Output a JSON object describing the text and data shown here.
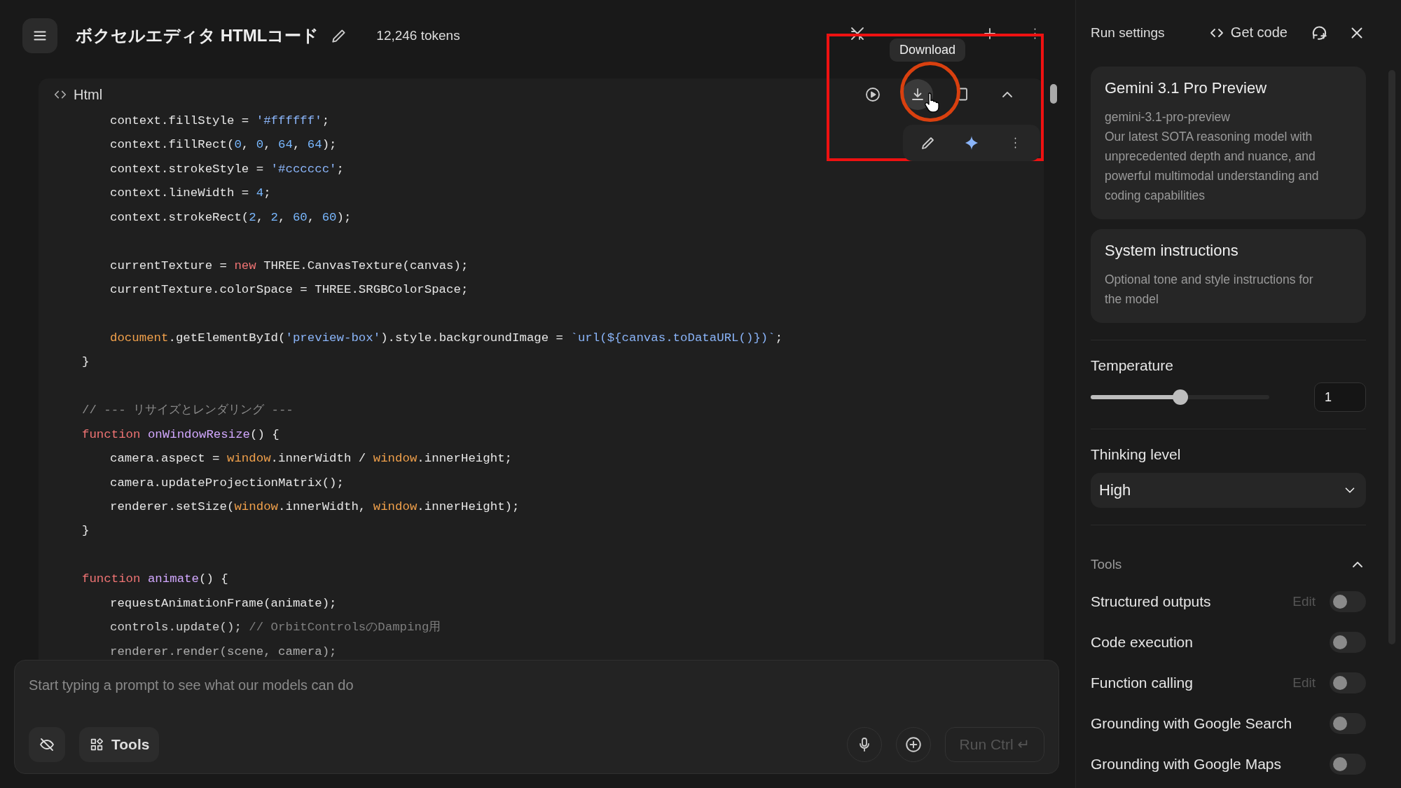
{
  "header": {
    "title": "ボクセルエディタ HTMLコード",
    "token_count": "12,246 tokens"
  },
  "code_block": {
    "language": "Html",
    "tooltip": "Download",
    "lines": [
      {
        "kind": "inner",
        "tokens": [
          {
            "text": "context.fillStyle = ",
            "kind": "plain"
          },
          {
            "text": "'#ffffff'",
            "kind": "string"
          },
          {
            "text": ";",
            "kind": "plain"
          }
        ]
      },
      {
        "kind": "inner",
        "tokens": [
          {
            "text": "context.fillRect(",
            "kind": "plain"
          },
          {
            "text": "0",
            "kind": "number"
          },
          {
            "text": ", ",
            "kind": "plain"
          },
          {
            "text": "0",
            "kind": "number"
          },
          {
            "text": ", ",
            "kind": "plain"
          },
          {
            "text": "64",
            "kind": "number"
          },
          {
            "text": ", ",
            "kind": "plain"
          },
          {
            "text": "64",
            "kind": "number"
          },
          {
            "text": ");",
            "kind": "plain"
          }
        ]
      },
      {
        "kind": "inner",
        "tokens": [
          {
            "text": "context.strokeStyle = ",
            "kind": "plain"
          },
          {
            "text": "'#cccccc'",
            "kind": "string"
          },
          {
            "text": ";",
            "kind": "plain"
          }
        ]
      },
      {
        "kind": "inner",
        "tokens": [
          {
            "text": "context.lineWidth = ",
            "kind": "plain"
          },
          {
            "text": "4",
            "kind": "number"
          },
          {
            "text": ";",
            "kind": "plain"
          }
        ]
      },
      {
        "kind": "inner",
        "tokens": [
          {
            "text": "context.strokeRect(",
            "kind": "plain"
          },
          {
            "text": "2",
            "kind": "number"
          },
          {
            "text": ", ",
            "kind": "plain"
          },
          {
            "text": "2",
            "kind": "number"
          },
          {
            "text": ", ",
            "kind": "plain"
          },
          {
            "text": "60",
            "kind": "number"
          },
          {
            "text": ", ",
            "kind": "plain"
          },
          {
            "text": "60",
            "kind": "number"
          },
          {
            "text": ");",
            "kind": "plain"
          }
        ]
      },
      {
        "kind": "blank"
      },
      {
        "kind": "inner",
        "tokens": [
          {
            "text": "currentTexture = ",
            "kind": "plain"
          },
          {
            "text": "new",
            "kind": "keyword"
          },
          {
            "text": " THREE.CanvasTexture(canvas);",
            "kind": "plain"
          }
        ]
      },
      {
        "kind": "inner",
        "tokens": [
          {
            "text": "currentTexture.colorSpace = THREE.SRGBColorSpace;",
            "kind": "plain"
          }
        ]
      },
      {
        "kind": "blank"
      },
      {
        "kind": "inner",
        "tokens": [
          {
            "text": "document",
            "kind": "global"
          },
          {
            "text": ".getElementById(",
            "kind": "plain"
          },
          {
            "text": "'preview-box'",
            "kind": "string"
          },
          {
            "text": ").style.backgroundImage = ",
            "kind": "plain"
          },
          {
            "text": "`url(${canvas.toDataURL()})`",
            "kind": "string"
          },
          {
            "text": ";",
            "kind": "plain"
          }
        ]
      },
      {
        "kind": "top",
        "tokens": [
          {
            "text": "}",
            "kind": "plain"
          }
        ]
      },
      {
        "kind": "blank"
      },
      {
        "kind": "top",
        "tokens": [
          {
            "text": "// --- リサイズとレンダリング ---",
            "kind": "comment"
          }
        ]
      },
      {
        "kind": "top",
        "tokens": [
          {
            "text": "function ",
            "kind": "keyword"
          },
          {
            "text": "onWindowResize",
            "kind": "func"
          },
          {
            "text": "() {",
            "kind": "plain"
          }
        ]
      },
      {
        "kind": "inner",
        "tokens": [
          {
            "text": "camera.aspect = ",
            "kind": "plain"
          },
          {
            "text": "window",
            "kind": "global"
          },
          {
            "text": ".innerWidth / ",
            "kind": "plain"
          },
          {
            "text": "window",
            "kind": "global"
          },
          {
            "text": ".innerHeight;",
            "kind": "plain"
          }
        ]
      },
      {
        "kind": "inner",
        "tokens": [
          {
            "text": "camera.updateProjectionMatrix();",
            "kind": "plain"
          }
        ]
      },
      {
        "kind": "inner",
        "tokens": [
          {
            "text": "renderer.setSize(",
            "kind": "plain"
          },
          {
            "text": "window",
            "kind": "global"
          },
          {
            "text": ".innerWidth, ",
            "kind": "plain"
          },
          {
            "text": "window",
            "kind": "global"
          },
          {
            "text": ".innerHeight);",
            "kind": "plain"
          }
        ]
      },
      {
        "kind": "top",
        "tokens": [
          {
            "text": "}",
            "kind": "plain"
          }
        ]
      },
      {
        "kind": "blank"
      },
      {
        "kind": "top",
        "tokens": [
          {
            "text": "function ",
            "kind": "keyword"
          },
          {
            "text": "animate",
            "kind": "func"
          },
          {
            "text": "() {",
            "kind": "plain"
          }
        ]
      },
      {
        "kind": "inner",
        "tokens": [
          {
            "text": "requestAnimationFrame(animate);",
            "kind": "plain"
          }
        ]
      },
      {
        "kind": "inner",
        "tokens": [
          {
            "text": "controls.update(); ",
            "kind": "plain"
          },
          {
            "text": "// OrbitControlsのDamping用",
            "kind": "comment"
          }
        ]
      },
      {
        "kind": "inner",
        "tokens": [
          {
            "text": "renderer.render(scene, camera);",
            "kind": "plain"
          }
        ]
      }
    ]
  },
  "prompt": {
    "placeholder": "Start typing a prompt to see what our models can do",
    "tools_button": "Tools",
    "run_button": {
      "label": "Run Ctrl",
      "shortcut": "↵",
      "disabled": true
    }
  },
  "run_settings": {
    "title": "Run settings",
    "get_code": "Get code",
    "model": {
      "name": "Gemini 3.1 Pro Preview",
      "id": "gemini-3.1-pro-preview",
      "description": "Our latest SOTA reasoning model with unprecedented depth and nuance, and powerful multimodal understanding and coding capabilities"
    },
    "system_instructions": {
      "title": "System instructions",
      "placeholder": "Optional tone and style instructions for the model"
    },
    "temperature": {
      "label": "Temperature",
      "level": 0.5,
      "value": "1"
    },
    "thinking_level": {
      "label": "Thinking level",
      "value": "High"
    },
    "tools": {
      "label": "Tools",
      "expanded": true,
      "items": [
        {
          "label": "Structured outputs",
          "edit": "Edit",
          "on": false
        },
        {
          "label": "Code execution",
          "on": false
        },
        {
          "label": "Function calling",
          "edit": "Edit",
          "on": false
        },
        {
          "label": "Grounding with Google Search",
          "on": false
        },
        {
          "label": "Grounding with Google Maps",
          "on": false
        }
      ]
    }
  }
}
